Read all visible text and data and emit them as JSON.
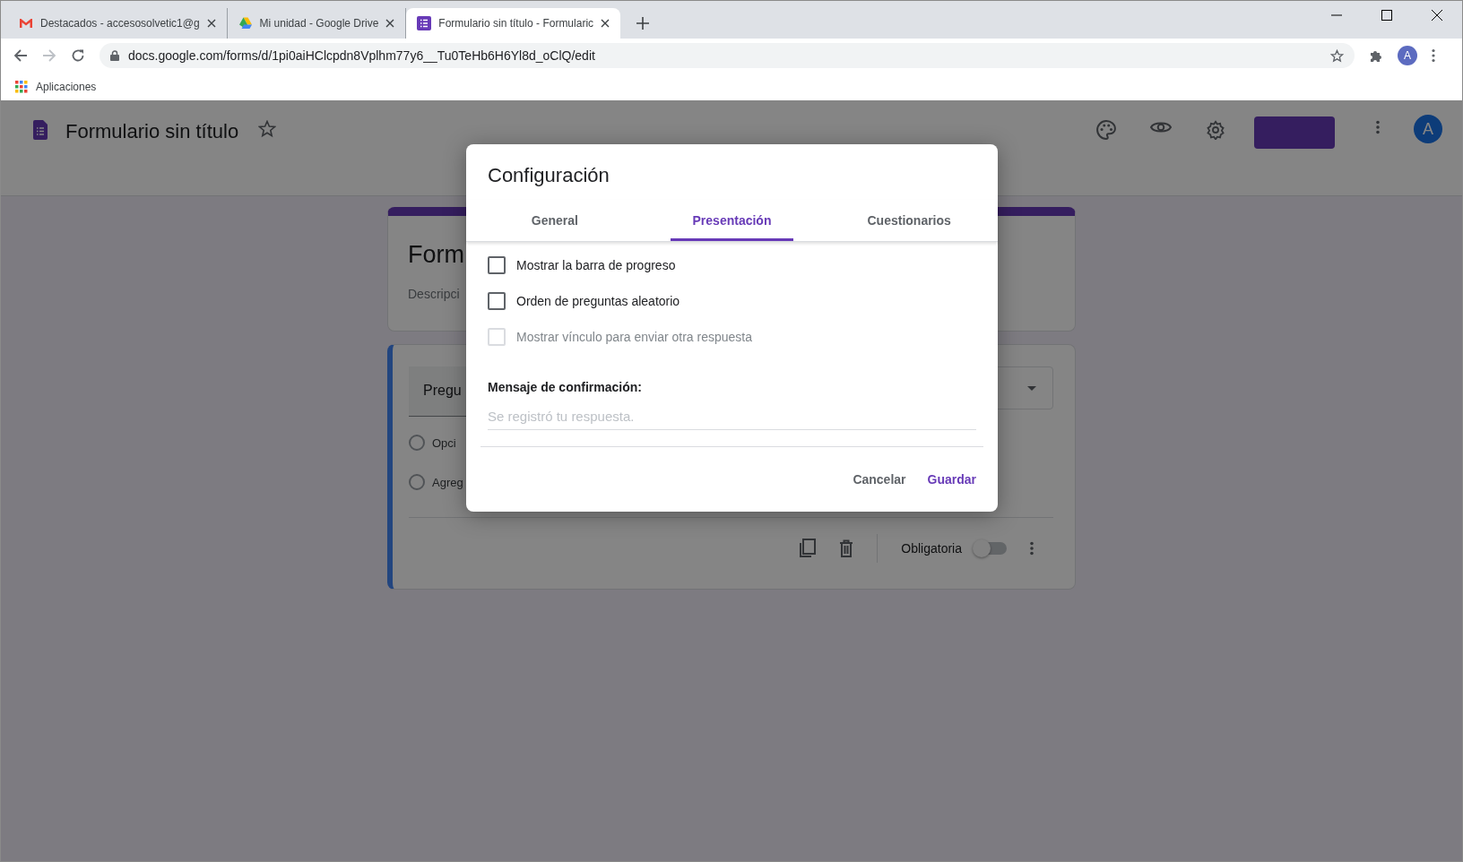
{
  "browser": {
    "tabs": [
      {
        "title": "Destacados - accesosolvetic1@g",
        "kind": "gmail",
        "selected": false
      },
      {
        "title": "Mi unidad - Google Drive",
        "kind": "drive",
        "selected": false
      },
      {
        "title": "Formulario sin título - Formularic",
        "kind": "forms",
        "selected": true
      }
    ],
    "address": "docs.google.com/forms/d/1pi0aiHClcpdn8Vplhm77y6__Tu0TeHb6H6Yl8d_oClQ/edit",
    "bookmarks": [
      "Aplicaciones"
    ],
    "profile_initial": "A"
  },
  "app_header": {
    "title": "Formulario sin título",
    "avatar_initial": "A"
  },
  "form": {
    "title": "Form",
    "description": "Descripci",
    "question": {
      "title": "Pregu",
      "options": [
        {
          "label": "Opci",
          "selected": false
        },
        {
          "label": "Agreg",
          "selected": false
        }
      ],
      "required_label": "Obligatoria",
      "required": false
    }
  },
  "dialog": {
    "title": "Configuración",
    "tabs": [
      {
        "label": "General",
        "selected": false
      },
      {
        "label": "Presentación",
        "selected": true
      },
      {
        "label": "Cuestionarios",
        "selected": false
      }
    ],
    "options": [
      {
        "label": "Mostrar la barra de progreso",
        "checked": false,
        "disabled": false
      },
      {
        "label": "Orden de preguntas aleatorio",
        "checked": false,
        "disabled": false
      },
      {
        "label": "Mostrar vínculo para enviar otra respuesta",
        "checked": false,
        "disabled": true
      }
    ],
    "confirmation": {
      "label": "Mensaje de confirmación:",
      "placeholder": "Se registró tu respuesta."
    },
    "buttons": [
      {
        "label": "Cancelar",
        "kind": "secondary"
      },
      {
        "label": "Guardar",
        "kind": "primary"
      }
    ]
  }
}
